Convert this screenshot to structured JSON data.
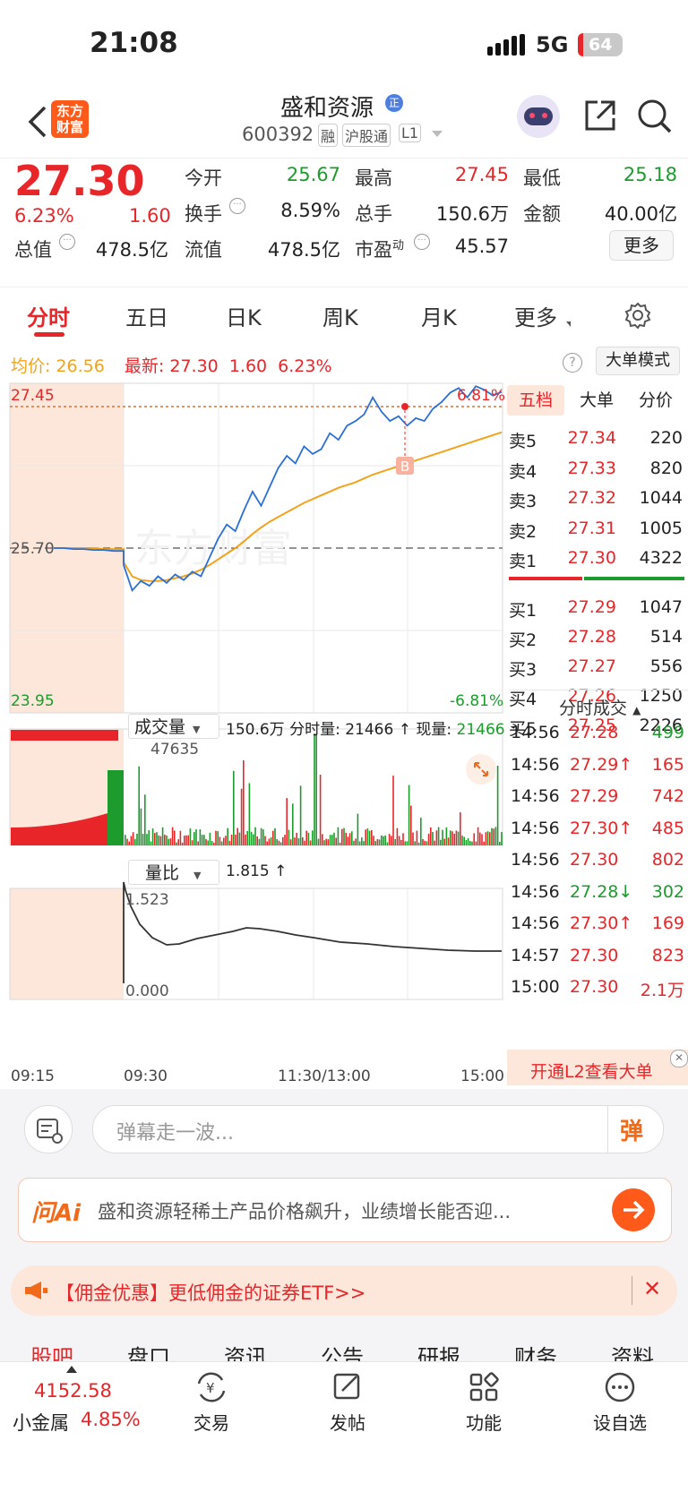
{
  "status_bar": {
    "time": "21:08",
    "network": "5G",
    "battery": "64"
  },
  "header": {
    "logo_line1": "东方",
    "logo_line2": "财富",
    "stock_name": "盛和资源",
    "name_badge": "正",
    "stock_code": "600392",
    "tags": [
      "融",
      "沪股通",
      "L1"
    ]
  },
  "quote": {
    "price": "27.30",
    "change_pct": "6.23%",
    "change": "1.60",
    "stats": [
      {
        "label": "今开",
        "value": "25.67",
        "color": "green"
      },
      {
        "label": "最高",
        "value": "27.45",
        "color": "red"
      },
      {
        "label": "最低",
        "value": "25.18",
        "color": "green"
      },
      {
        "label": "换手",
        "value": "8.59%",
        "color": "dark"
      },
      {
        "label": "总手",
        "value": "150.6万",
        "color": "dark"
      },
      {
        "label": "金额",
        "value": "40.00亿",
        "color": "dark"
      },
      {
        "label": "总值",
        "value": "478.5亿",
        "color": "dark"
      },
      {
        "label": "流值",
        "value": "478.5亿",
        "color": "dark"
      },
      {
        "label": "市盈",
        "sup": "动",
        "value": "45.57",
        "color": "dark"
      }
    ],
    "more_button": "更多"
  },
  "tabs": [
    "分时",
    "五日",
    "日K",
    "周K",
    "月K",
    "更多"
  ],
  "active_tab": "分时",
  "info_line": {
    "avg_label": "均价:",
    "avg_value": "26.56",
    "latest_label": "最新:",
    "latest_value": "27.30",
    "change": "1.60",
    "pct": "6.23%"
  },
  "big_order_mode": "大单模式",
  "chart_data": {
    "type": "line",
    "y_top": "27.45",
    "y_mid": "25.70",
    "y_bottom": "23.95",
    "pct_top": "6.81%",
    "pct_bottom": "-6.81%",
    "ylim": [
      23.95,
      27.45
    ],
    "prev_close": 25.7,
    "marker": "B",
    "series": [
      {
        "values": [
          25.7,
          25.7,
          25.69,
          25.69,
          25.68,
          25.68,
          25.67,
          25.67,
          25.52,
          25.25,
          25.35,
          25.3,
          25.4,
          25.33,
          25.42,
          25.36,
          25.45,
          25.4,
          25.6,
          25.8,
          25.95,
          25.88,
          26.1,
          26.3,
          26.15,
          26.35,
          26.55,
          26.68,
          26.6,
          26.78,
          26.7,
          26.75,
          26.92,
          26.85,
          27.0,
          27.05,
          27.12,
          27.3,
          27.15,
          27.05,
          27.1,
          27.0,
          27.08,
          27.05,
          27.18,
          27.25,
          27.35,
          27.4,
          27.3,
          27.42,
          27.38,
          27.32,
          27.36
        ]
      },
      {
        "values": [
          25.7,
          25.7,
          25.7,
          25.7,
          25.7,
          25.69,
          25.69,
          25.69,
          25.55,
          25.4,
          25.36,
          25.35,
          25.35,
          25.36,
          25.38,
          25.4,
          25.43,
          25.47,
          25.52,
          25.58,
          25.64,
          25.7,
          25.77,
          25.85,
          25.92,
          25.98,
          26.03,
          26.08,
          26.13,
          26.18,
          26.22,
          26.26,
          26.3,
          26.34,
          26.37,
          26.4,
          26.44,
          26.48,
          26.51,
          26.54,
          26.57,
          26.6,
          26.63,
          26.66,
          26.69,
          26.72,
          26.75,
          26.78,
          26.81,
          26.84,
          26.87,
          26.9,
          26.93
        ]
      }
    ]
  },
  "volume": {
    "selector": "成交量",
    "total": "150.6万",
    "label_fen": "分时量:",
    "fen_value": "21466",
    "label_now": "现量:",
    "now_value": "21466",
    "max": "47635"
  },
  "ratio": {
    "selector": "量比",
    "value": "1.815",
    "max": "1.523",
    "min": "0.000"
  },
  "time_axis": [
    "09:15",
    "09:30",
    "11:30/13:00",
    "15:00"
  ],
  "orderbook": {
    "tabs": [
      "五档",
      "大单",
      "分价"
    ],
    "sells": [
      {
        "label": "卖5",
        "price": "27.34",
        "vol": "220"
      },
      {
        "label": "卖4",
        "price": "27.33",
        "vol": "820"
      },
      {
        "label": "卖3",
        "price": "27.32",
        "vol": "1044"
      },
      {
        "label": "卖2",
        "price": "27.31",
        "vol": "1005"
      },
      {
        "label": "卖1",
        "price": "27.30",
        "vol": "4322"
      }
    ],
    "buys": [
      {
        "label": "买1",
        "price": "27.29",
        "vol": "1047"
      },
      {
        "label": "买2",
        "price": "27.28",
        "vol": "514"
      },
      {
        "label": "买3",
        "price": "27.27",
        "vol": "556"
      },
      {
        "label": "买4",
        "price": "27.26",
        "vol": "1250"
      },
      {
        "label": "买5",
        "price": "27.25",
        "vol": "2226"
      }
    ]
  },
  "trades": {
    "title": "分时成交",
    "rows": [
      {
        "time": "14:56",
        "price": "27.28",
        "arrow": "",
        "vol": "499",
        "color": "green"
      },
      {
        "time": "14:56",
        "price": "27.29",
        "arrow": "↑",
        "vol": "165",
        "color": "red"
      },
      {
        "time": "14:56",
        "price": "27.29",
        "arrow": "",
        "vol": "742",
        "color": "red"
      },
      {
        "time": "14:56",
        "price": "27.30",
        "arrow": "↑",
        "vol": "485",
        "color": "red"
      },
      {
        "time": "14:56",
        "price": "27.30",
        "arrow": "",
        "vol": "802",
        "color": "red"
      },
      {
        "time": "14:56",
        "price": "27.28",
        "arrow": "↓",
        "vol": "302",
        "color": "green"
      },
      {
        "time": "14:56",
        "price": "27.30",
        "arrow": "↑",
        "vol": "169",
        "color": "red"
      },
      {
        "time": "14:57",
        "price": "27.30",
        "arrow": "",
        "vol": "823",
        "color": "red"
      },
      {
        "time": "15:00",
        "price": "27.30",
        "arrow": "",
        "vol": "2.1万",
        "color": "red"
      }
    ],
    "l2_promo": "开通L2查看大单"
  },
  "comment": {
    "placeholder": "弹幕走一波...",
    "danmu": "弹"
  },
  "ai": {
    "logo": "问Ai",
    "text": "盛和资源轻稀土产品价格飙升，业绩增长能否迎..."
  },
  "promo": {
    "text": "【佣金优惠】更低佣金的证券ETF>>"
  },
  "section_tabs": [
    "股吧",
    "盘口",
    "资讯",
    "公告",
    "研报",
    "财务",
    "资料"
  ],
  "bottom_bar": {
    "index_value": "4152.58",
    "index_name": "小金属",
    "index_pct": "4.85%",
    "items": [
      "交易",
      "发帖",
      "功能",
      "设自选"
    ]
  },
  "colors": {
    "up": "#e8262a",
    "down": "#1d9b2d",
    "accent": "#ff6a00",
    "price_line": "#2b6fd6",
    "avg_line": "#f2a31c"
  }
}
